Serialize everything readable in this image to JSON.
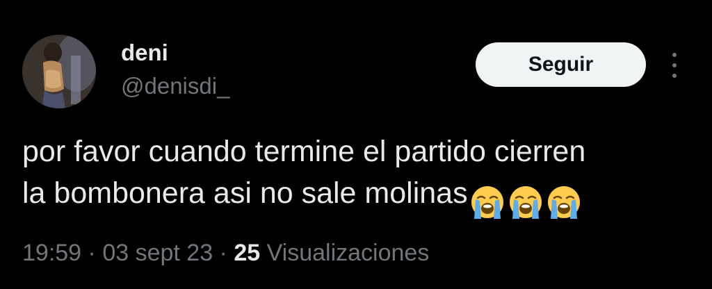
{
  "author": {
    "display_name": "deni",
    "handle": "@denisdi_"
  },
  "actions": {
    "follow_label": "Seguir"
  },
  "tweet": {
    "text_line1": "por favor cuando termine el partido cierren",
    "text_line2": "la bombonera asi no sale molinas",
    "emojis": [
      "loudly-crying-face",
      "loudly-crying-face",
      "loudly-crying-face"
    ]
  },
  "meta": {
    "time": "19:59",
    "separator1": " · ",
    "date": "03 sept 23",
    "separator2": " · ",
    "views_count": "25",
    "views_label": " Visualizaciones"
  },
  "colors": {
    "background": "#000000",
    "primary_text": "#e7e9ea",
    "secondary_text": "#71767b",
    "button_bg": "#eff3f4",
    "button_text": "#0f1419"
  }
}
